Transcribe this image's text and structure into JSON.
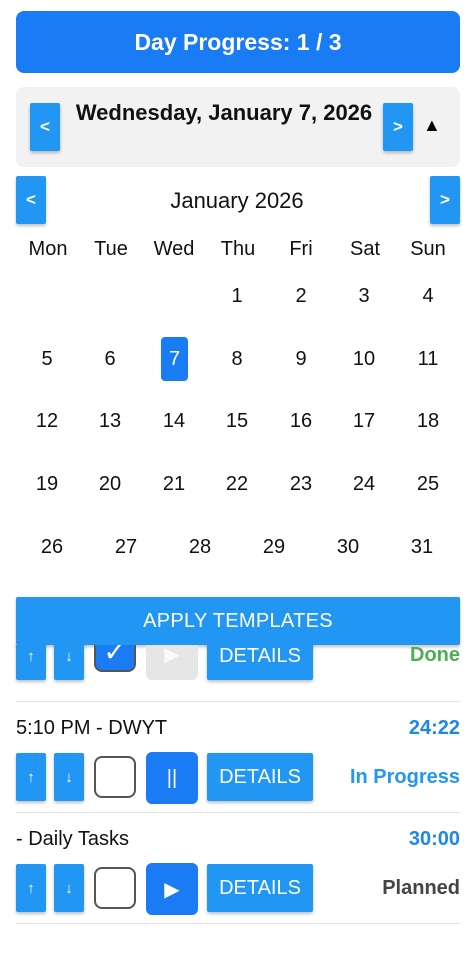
{
  "progress": {
    "label": "Day Progress: 1 / 3",
    "color": "#1a7cf5"
  },
  "day_header": {
    "title": "Wednesday, January 7, 2026",
    "prev_label": "<",
    "next_label": ">",
    "toggle_icon": "▲"
  },
  "calendar": {
    "month_label": "January 2026",
    "prev_label": "<",
    "next_label": ">",
    "weekdays": [
      "Mon",
      "Tue",
      "Wed",
      "Thu",
      "Fri",
      "Sat",
      "Sun"
    ],
    "rows": [
      [
        "",
        "",
        "",
        "1",
        "2",
        "3",
        "4"
      ],
      [
        "5",
        "6",
        "7",
        "8",
        "9",
        "10",
        "11"
      ],
      [
        "12",
        "13",
        "14",
        "15",
        "16",
        "17",
        "18"
      ],
      [
        "19",
        "20",
        "21",
        "22",
        "23",
        "24",
        "25"
      ],
      [
        "26",
        "27",
        "28",
        "29",
        "30",
        "31"
      ]
    ],
    "selected_day": "7"
  },
  "apply_templates_label": "APPLY TEMPLATES",
  "tasks": [
    {
      "title": "",
      "time": "",
      "checked": true,
      "check_glyph": "✓",
      "play_glyph": "▶",
      "play_disabled": true,
      "details_label": "DETAILS",
      "status": "Done",
      "status_color": "#4caf50",
      "up_glyph": "↑",
      "down_glyph": "↓"
    },
    {
      "title": "5:10 PM - DWYT",
      "time": "24:22",
      "checked": false,
      "check_glyph": "",
      "play_glyph": "||",
      "play_disabled": false,
      "details_label": "DETAILS",
      "status": "In Progress",
      "status_color": "#2196f3",
      "up_glyph": "↑",
      "down_glyph": "↓"
    },
    {
      "title": " - Daily Tasks",
      "time": "30:00",
      "checked": false,
      "check_glyph": "",
      "play_glyph": "▶",
      "play_disabled": false,
      "details_label": "DETAILS",
      "status": "Planned",
      "status_color": "#444444",
      "up_glyph": "↑",
      "down_glyph": "↓"
    }
  ]
}
